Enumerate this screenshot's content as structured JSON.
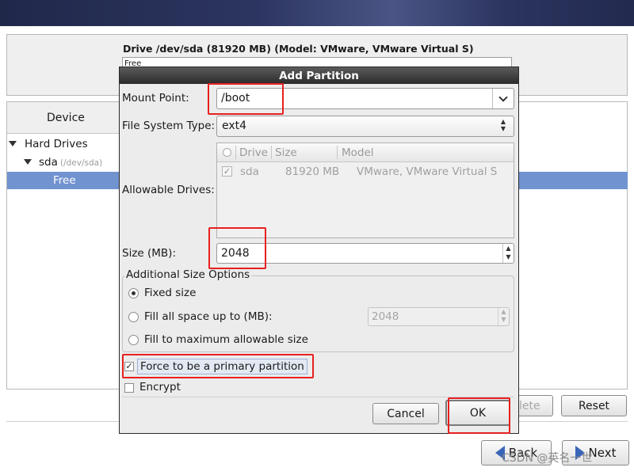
{
  "drive": {
    "title": "Drive /dev/sda (81920 MB) (Model: VMware, VMware Virtual S)",
    "bar_text": "Free"
  },
  "tree": {
    "header": "Device",
    "hard_drives": "Hard Drives",
    "sda": "sda",
    "sda_dev": "(/dev/sda)",
    "free": "Free"
  },
  "main_buttons": {
    "delete": "lete",
    "reset": "Reset",
    "back": "Back",
    "next": "Next"
  },
  "watermark": "CSDN @英名一世",
  "dialog": {
    "title": "Add Partition",
    "mount_point_label": "Mount Point:",
    "mount_point_value": "/boot",
    "fs_type_label": "File System Type:",
    "fs_type_value": "ext4",
    "allowable_drives_label": "Allowable Drives:",
    "drives_table": {
      "headers": [
        "Drive",
        "Size",
        "Model"
      ],
      "rows": [
        {
          "checked": true,
          "drive": "sda",
          "size": "81920 MB",
          "model": "VMware, VMware Virtual S"
        }
      ]
    },
    "size_label": "Size (MB):",
    "size_value": "2048",
    "additional_size_options": {
      "title": "Additional Size Options",
      "fixed": "Fixed size",
      "fill_up_to": "Fill all space up to (MB):",
      "fill_up_to_value": "2048",
      "fill_max": "Fill to maximum allowable size",
      "selected": "fixed"
    },
    "force_primary_label": "Force to be a primary partition",
    "force_primary_checked": true,
    "encrypt_label": "Encrypt",
    "encrypt_checked": false,
    "cancel": "Cancel",
    "ok": "OK"
  },
  "colors": {
    "selection": "#7193cf",
    "highlight_box": "#e82020",
    "arrow": "#3a66b8"
  },
  "icons": {
    "back": "arrow-left-icon",
    "next": "arrow-right-icon",
    "expander": "triangle-down-icon",
    "dropdown": "chevron-down-icon",
    "spin": "spin-arrows-icon"
  }
}
